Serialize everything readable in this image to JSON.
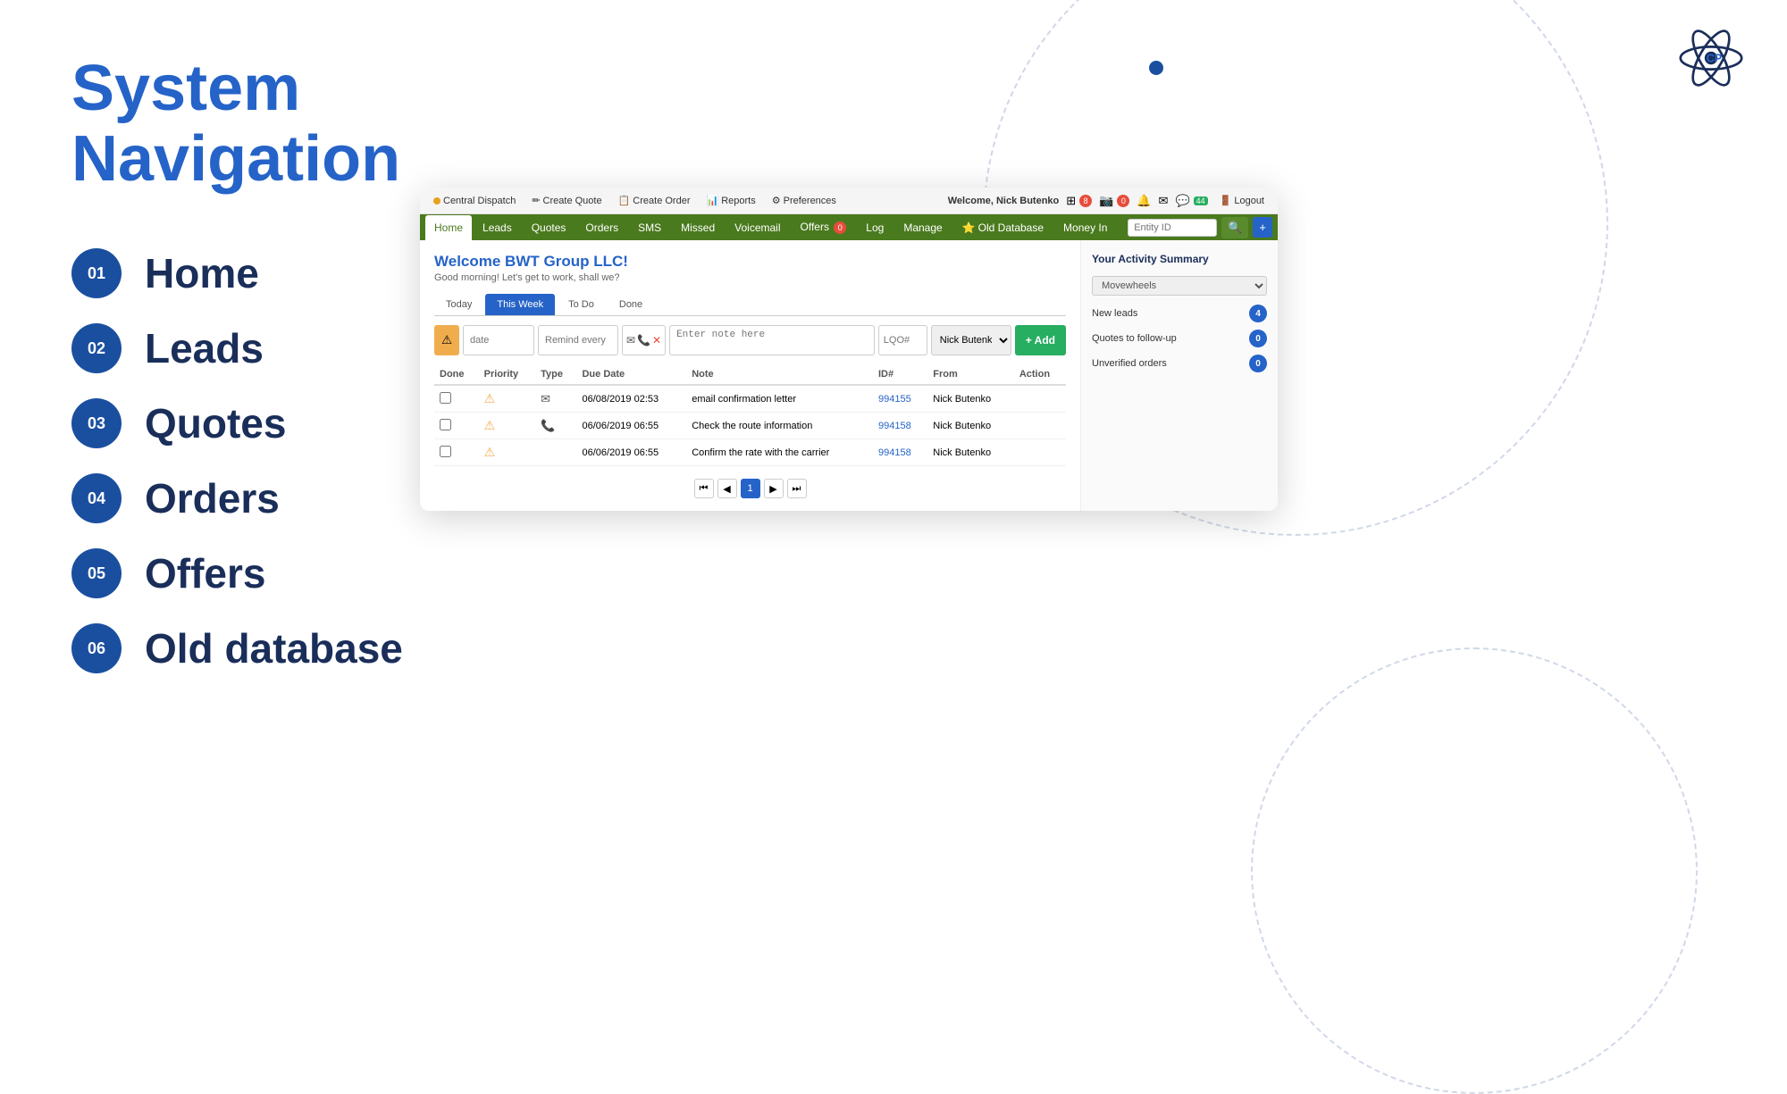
{
  "page": {
    "title_part1": "System",
    "title_part2": "Navigation"
  },
  "nav_items": [
    {
      "number": "01",
      "label": "Home"
    },
    {
      "number": "02",
      "label": "Leads"
    },
    {
      "number": "03",
      "label": "Quotes"
    },
    {
      "number": "04",
      "label": "Orders"
    },
    {
      "number": "05",
      "label": "Offers"
    },
    {
      "number": "06",
      "label": "Old database"
    }
  ],
  "browser": {
    "toolbar": {
      "central_dispatch": "Central Dispatch",
      "create_quote": "Create Quote",
      "create_order": "Create Order",
      "reports": "Reports",
      "preferences": "Preferences",
      "user": "Welcome, Nick Butenko",
      "logout": "Logout"
    },
    "navbar": {
      "items": [
        "Home",
        "Leads",
        "Quotes",
        "Orders",
        "SMS",
        "Missed",
        "Voicemail",
        "Offers",
        "Log",
        "Manage",
        "Old Database",
        "Money In"
      ],
      "active": "Home",
      "offers_badge": "0",
      "entity_placeholder": "Entity ID"
    },
    "welcome_title": "Welcome BWT Group LLC!",
    "welcome_subtitle": "Good morning! Let's get to work, shall we?",
    "tabs": [
      "Today",
      "This Week",
      "To Do",
      "Done"
    ],
    "active_tab": "This Week",
    "form": {
      "date_placeholder": "date",
      "remind_placeholder": "Remind every",
      "note_placeholder": "Enter note here",
      "lqo_placeholder": "LQO#",
      "user_value": "Nick Butenko",
      "add_label": "+ Add"
    },
    "table": {
      "headers": [
        "Done",
        "Priority",
        "Type",
        "Due Date",
        "Note",
        "ID#",
        "From",
        "Action"
      ],
      "rows": [
        {
          "done": false,
          "priority": "warning",
          "type": "email",
          "due_date": "06/08/2019 02:53",
          "note": "email confirmation letter",
          "id": "994155",
          "from": "Nick Butenko",
          "action": ""
        },
        {
          "done": false,
          "priority": "warning",
          "type": "phone",
          "due_date": "06/06/2019 06:55",
          "note": "Check the route information",
          "id": "994158",
          "from": "Nick Butenko",
          "action": ""
        },
        {
          "done": false,
          "priority": "warning",
          "type": "",
          "due_date": "06/06/2019 06:55",
          "note": "Confirm the rate with the carrier",
          "id": "994158",
          "from": "Nick Butenko",
          "action": ""
        }
      ]
    },
    "pagination": {
      "current": 1,
      "pages": [
        1
      ]
    },
    "activity_summary": {
      "title": "Your Activity Summary",
      "dropdown": "Movewheels",
      "items": [
        {
          "label": "New leads",
          "count": "4"
        },
        {
          "label": "Quotes to follow-up",
          "count": "0"
        },
        {
          "label": "Unverified orders",
          "count": "0"
        }
      ]
    }
  }
}
